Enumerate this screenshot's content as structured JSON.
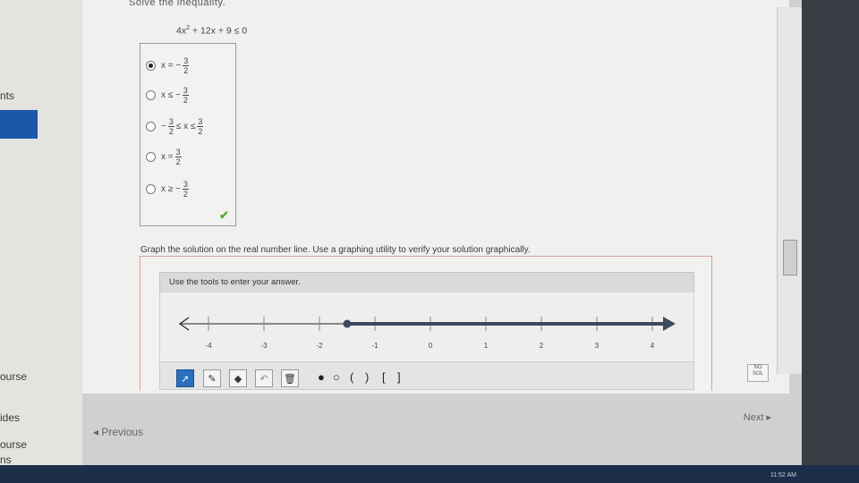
{
  "sidebar": {
    "items": [
      {
        "label": "nts"
      },
      {
        "label": "ourse"
      },
      {
        "label": "ides"
      },
      {
        "label": "ourse"
      },
      {
        "label": "ns"
      }
    ]
  },
  "question": {
    "heading": "Solve the inequality.",
    "equation": {
      "a": "4x",
      "exp": "2",
      "rest": " + 12x + 9 ≤ 0"
    },
    "choices": [
      {
        "prefix": "x = −",
        "num": "3",
        "den": "2",
        "suffix": "",
        "selected": true
      },
      {
        "prefix": "x ≤ −",
        "num": "3",
        "den": "2",
        "suffix": "",
        "selected": false
      },
      {
        "prefix": "−",
        "num": "3",
        "den": "2",
        "suffix": "≤ x ≤",
        "num2": "3",
        "den2": "2",
        "selected": false
      },
      {
        "prefix": "x =",
        "num": "3",
        "den": "2",
        "suffix": "",
        "selected": false
      },
      {
        "prefix": "x ≥ −",
        "num": "3",
        "den": "2",
        "suffix": "",
        "selected": false
      }
    ],
    "check_icon": "check-icon"
  },
  "graph": {
    "instruction": "Graph the solution on the real number line. Use a graphing utility to verify your solution graphically.",
    "tools_label": "Use the tools to enter your answer.",
    "ticks": [
      "-4",
      "-3",
      "-2",
      "-1",
      "0",
      "1",
      "2",
      "3",
      "4"
    ],
    "point": -1.5,
    "shaded_from": -1.5,
    "shaded_direction": "right",
    "colors": {
      "ray": "#3b4a5c",
      "axis": "#222222"
    },
    "tools": [
      "pointer-icon",
      "pencil-icon",
      "eraser-icon",
      "undo-icon",
      "trash-icon"
    ],
    "symbols": [
      "●",
      "○",
      "(",
      ")",
      "[",
      "]"
    ],
    "nosol": {
      "line1": "NO",
      "line2": "SOL"
    }
  },
  "nav": {
    "previous": "◂ Previous",
    "next": "Next ▸"
  },
  "taskbar": {
    "clock": "11:52 AM"
  }
}
